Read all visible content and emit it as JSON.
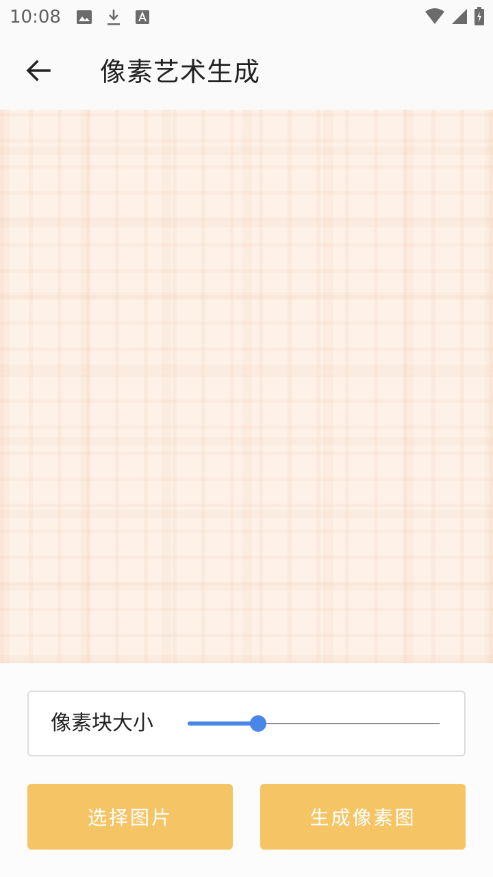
{
  "status_bar": {
    "time": "10:08",
    "icons_left": [
      "image-icon",
      "download-icon",
      "text-a-icon"
    ],
    "icons_right": [
      "wifi-icon",
      "signal-icon",
      "battery-charging-icon"
    ]
  },
  "app_bar": {
    "title": "像素艺术生成",
    "back_icon": "arrow-left-icon"
  },
  "controls": {
    "pixel_size_label": "像素块大小",
    "pixel_size_value": 0.28,
    "select_image_label": "选择图片",
    "generate_label": "生成像素图"
  },
  "colors": {
    "accent_blue": "#4a86e8",
    "button_yellow": "#f5c464",
    "canvas_bg": "#fdf1e8"
  }
}
